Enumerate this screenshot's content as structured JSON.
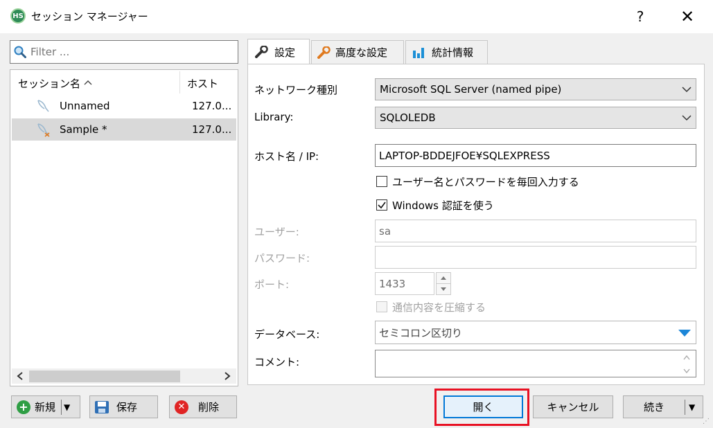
{
  "window": {
    "title": "セッション マネージャー",
    "app_icon_text": "HS",
    "help_label": "?",
    "close_label": "✕"
  },
  "filter": {
    "placeholder": "Filter ..."
  },
  "session_list": {
    "columns": {
      "name": "セッション名",
      "sort_indicator": "^",
      "host": "ホスト"
    },
    "rows": [
      {
        "name": "Unnamed",
        "host": "127.0...",
        "selected": false
      },
      {
        "name": "Sample *",
        "host": "127.0...",
        "selected": true
      }
    ],
    "scroll_left": "<",
    "scroll_right": ">"
  },
  "left_buttons": {
    "new": "新規",
    "new_arrow": "▼",
    "save": "保存",
    "delete": "削除"
  },
  "tabs": [
    {
      "label": "設定",
      "icon": "wrench-icon",
      "active": true
    },
    {
      "label": "高度な設定",
      "icon": "wrench-orange-icon",
      "active": false
    },
    {
      "label": "統計情報",
      "icon": "bar-chart-icon",
      "active": false
    }
  ],
  "settings": {
    "network_type": {
      "label": "ネットワーク種別",
      "value": "Microsoft SQL Server (named pipe)"
    },
    "library": {
      "label": "Library:",
      "value": "SQLOLEDB"
    },
    "hostname": {
      "label": "ホスト名 / IP:",
      "value": "LAPTOP-BDDEJFOE¥SQLEXPRESS"
    },
    "prompt_credentials": {
      "label": "ユーザー名とパスワードを毎回入力する",
      "checked": false
    },
    "windows_auth": {
      "label": "Windows 認証を使う",
      "checked": true
    },
    "user": {
      "label": "ユーザー:",
      "value": "sa"
    },
    "password": {
      "label": "パスワード:",
      "value": ""
    },
    "port": {
      "label": "ポート:",
      "value": "1433"
    },
    "compress": {
      "label": "通信内容を圧縮する",
      "checked": false
    },
    "database": {
      "label": "データベース:",
      "value": "セミコロン区切り"
    },
    "comment": {
      "label": "コメント:",
      "value": ""
    }
  },
  "dialog_buttons": {
    "open": "開く",
    "cancel": "キャンセル",
    "continue": "続き",
    "continue_arrow": "▼"
  },
  "colors": {
    "accent": "#0078d7",
    "highlight": "#e81123",
    "new_icon": "#2e9e44",
    "delete_icon": "#e02424",
    "chart_icon": "#1b8fd6",
    "wrench_orange": "#e07a1f"
  }
}
